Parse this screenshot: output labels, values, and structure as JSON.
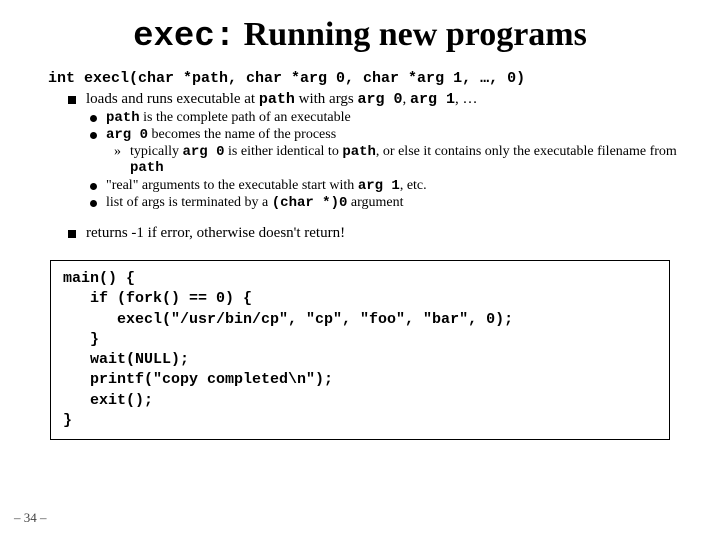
{
  "title_mono": "exec:",
  "title_rest": " Running new programs",
  "signature": "int execl(char *path, char *arg 0, char *arg 1, …, 0)",
  "b1_pre": "loads and runs executable at ",
  "b1_m1": "path",
  "b1_mid": " with args ",
  "b1_m2": "arg 0",
  "b1_mid2": ", ",
  "b1_m3": "arg 1",
  "b1_post": ", …",
  "s1_m1": "path",
  "s1_post": " is the complete path of an executable",
  "s2_m1": "arg 0",
  "s2_post": " becomes the name of the process",
  "t1_pre": "typically ",
  "t1_m1": "arg 0",
  "t1_mid": " is either identical to ",
  "t1_m2": "path",
  "t1_mid2": ", or else it contains only the executable filename from ",
  "t1_m3": "path",
  "s3_pre": "\"real\" arguments to the executable start with ",
  "s3_m1": "arg 1",
  "s3_post": ", etc.",
  "s4_pre": "list of args is terminated by a ",
  "s4_m1": "(char *)0",
  "s4_post": " argument",
  "b2": "returns -1 if error, otherwise doesn't return!",
  "code": "main() {\n   if (fork() == 0) {\n      execl(\"/usr/bin/cp\", \"cp\", \"foo\", \"bar\", 0);\n   }\n   wait(NULL);\n   printf(\"copy completed\\n\");\n   exit();\n}",
  "pagenum": "– 34 –"
}
